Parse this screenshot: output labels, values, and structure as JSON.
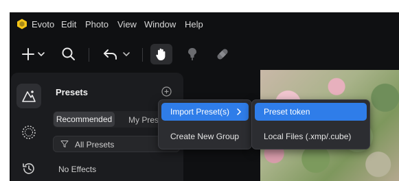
{
  "app": {
    "name": "Evoto"
  },
  "menubar": {
    "items": [
      "Evoto",
      "Edit",
      "Photo",
      "View",
      "Window",
      "Help"
    ]
  },
  "toolbar": {
    "tools": [
      "add-icon",
      "chevron-down-icon",
      "search-icon",
      "undo-icon",
      "chevron-down-icon",
      "hand-icon",
      "stamp-icon",
      "bandage-icon"
    ],
    "active_tool": "hand-icon"
  },
  "rail": {
    "items": [
      "presets-icon",
      "texture-icon",
      "history-icon"
    ],
    "active": "presets-icon"
  },
  "panel": {
    "title": "Presets",
    "tabs": {
      "recommended": "Recommended",
      "mine": "My Presets"
    },
    "filter": "All Presets",
    "empty_text": "No Effects"
  },
  "context_menu": {
    "items": [
      {
        "label": "Import Preset(s)",
        "highlighted": true,
        "has_submenu": true
      },
      {
        "label": "Create New Group",
        "highlighted": false
      }
    ],
    "submenu": [
      {
        "label": "Preset token",
        "highlighted": true
      },
      {
        "label": "Local Files (.xmp/.cube)",
        "highlighted": false
      }
    ]
  },
  "colors": {
    "accent": "#2f7de9",
    "background": "#0f1012",
    "panel": "#1b1c1f",
    "logo": "#f5c518"
  }
}
